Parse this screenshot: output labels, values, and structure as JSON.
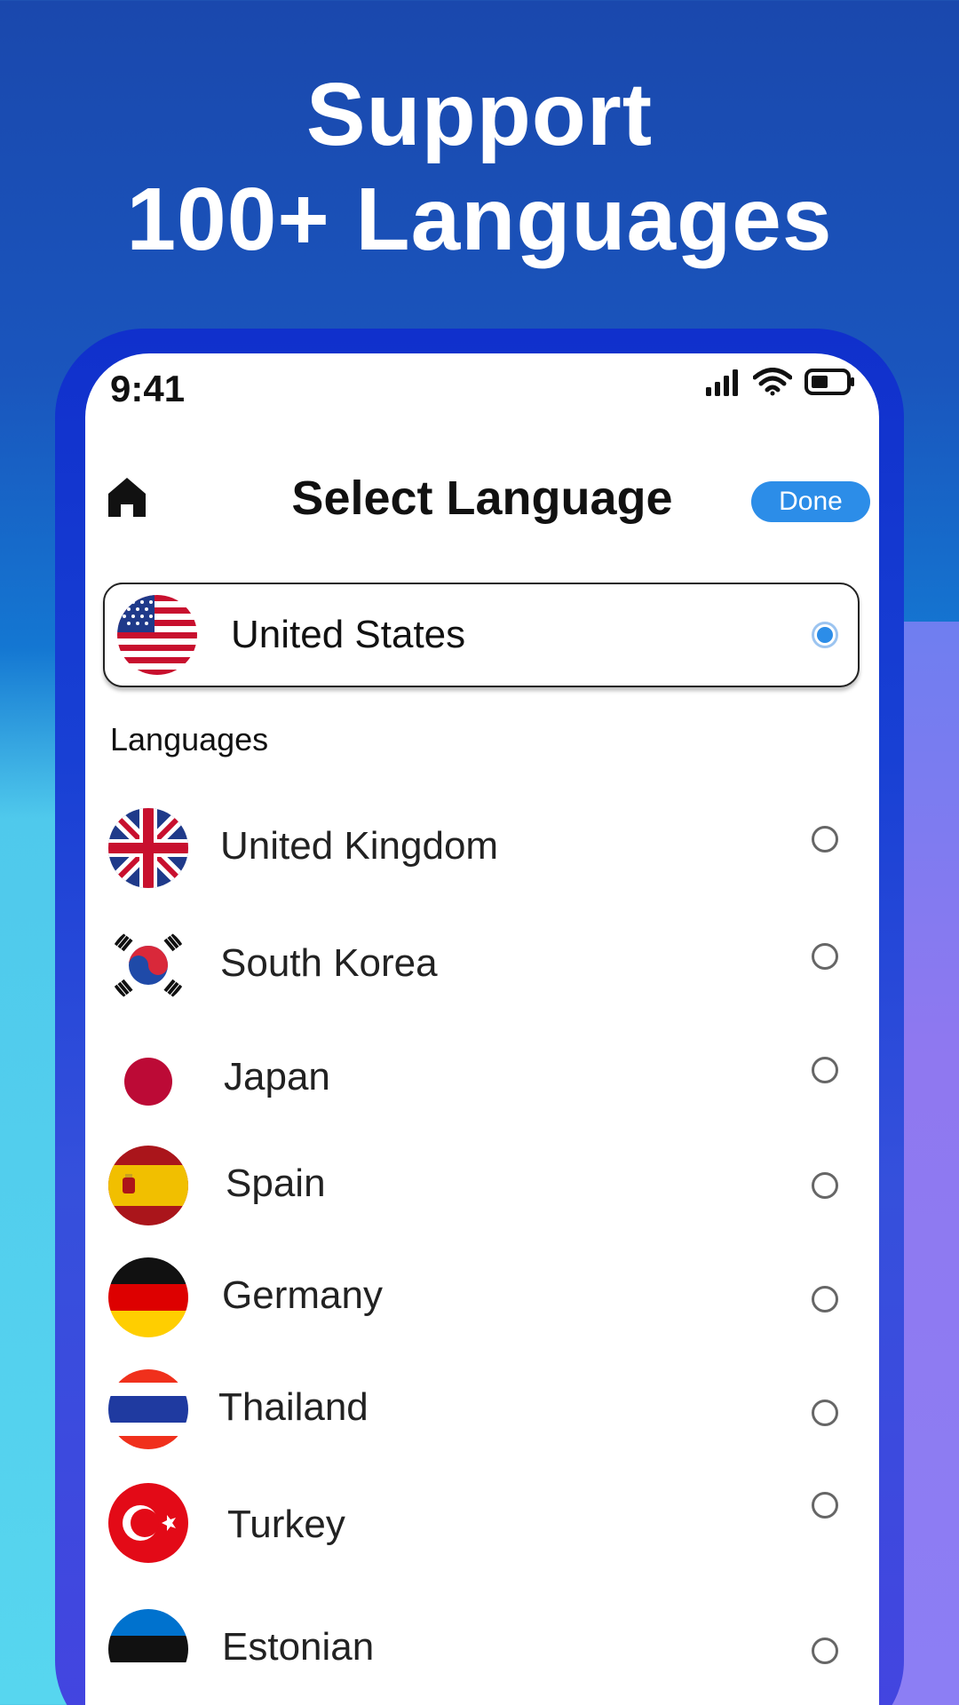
{
  "headline": {
    "line1": "Support",
    "line2": "100+ Languages"
  },
  "status_bar": {
    "time": "9:41"
  },
  "nav": {
    "title": "Select Language",
    "done_label": "Done"
  },
  "selected": {
    "name": "United States",
    "flag_icon": "us-flag-icon"
  },
  "section_label": "Languages",
  "languages": [
    {
      "name": "United Kingdom",
      "flag_icon": "uk-flag-icon"
    },
    {
      "name": "South Korea",
      "flag_icon": "south-korea-flag-icon"
    },
    {
      "name": "Japan",
      "flag_icon": "japan-flag-icon"
    },
    {
      "name": "Spain",
      "flag_icon": "spain-flag-icon"
    },
    {
      "name": "Germany",
      "flag_icon": "germany-flag-icon"
    },
    {
      "name": "Thailand",
      "flag_icon": "thailand-flag-icon"
    },
    {
      "name": "Turkey",
      "flag_icon": "turkey-flag-icon"
    },
    {
      "name": "Estonian",
      "flag_icon": "estonia-flag-icon"
    }
  ],
  "colors": {
    "accent": "#2c8de8",
    "frame": "#1840d4",
    "background_top": "#1a48ad",
    "background_bottom": "#57d6ef"
  }
}
